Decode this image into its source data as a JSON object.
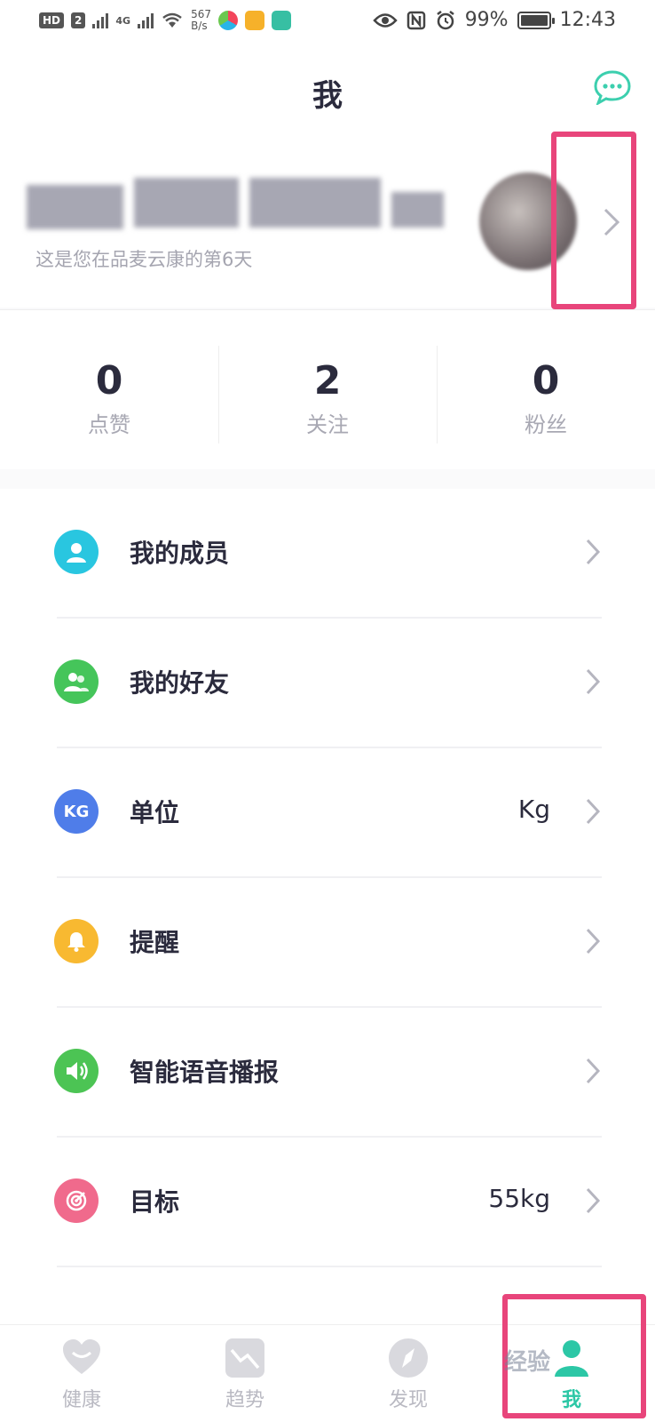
{
  "status_bar": {
    "hd_badge": "HD",
    "sim": "2",
    "network": "4G",
    "net_speed_value": "567",
    "net_speed_unit": "B/s",
    "battery": "99%",
    "time": "12:43"
  },
  "header": {
    "title": "我",
    "message_icon": "chat-bubble-icon"
  },
  "profile": {
    "subtitle": "这是您在品麦云康的第6天"
  },
  "stats": [
    {
      "value": "0",
      "label": "点赞"
    },
    {
      "value": "2",
      "label": "关注"
    },
    {
      "value": "0",
      "label": "粉丝"
    }
  ],
  "menu": [
    {
      "label": "我的成员",
      "value": "",
      "icon": "person-icon",
      "color": "#29c6e0"
    },
    {
      "label": "我的好友",
      "value": "",
      "icon": "friends-icon",
      "color": "#45c55a"
    },
    {
      "label": "单位",
      "value": "Kg",
      "icon_text": "KG",
      "icon": "kg-unit-icon",
      "color": "#4f7de9"
    },
    {
      "label": "提醒",
      "value": "",
      "icon": "bell-icon",
      "color": "#f8b931"
    },
    {
      "label": "智能语音播报",
      "value": "",
      "icon": "speaker-icon",
      "color": "#4cc454"
    },
    {
      "label": "目标",
      "value": "55kg",
      "icon": "target-icon",
      "color": "#f06a8c"
    }
  ],
  "tabbar": [
    {
      "label": "健康",
      "icon": "heart-icon",
      "active": false
    },
    {
      "label": "趋势",
      "icon": "trend-icon",
      "active": false
    },
    {
      "label": "发现",
      "icon": "compass-icon",
      "active": false
    },
    {
      "label": "我",
      "icon": "person-icon",
      "active": true
    }
  ],
  "colors": {
    "accent": "#2cc7a6",
    "highlight": "#e8457b"
  },
  "watermark": "经验"
}
